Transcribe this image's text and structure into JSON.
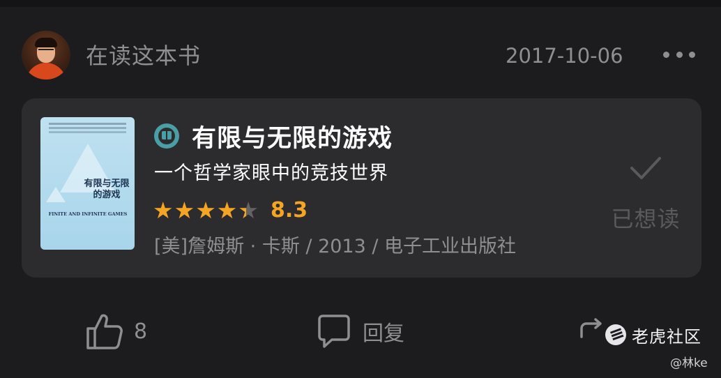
{
  "post": {
    "activity": "在读这本书",
    "date": "2017-10-06"
  },
  "book": {
    "title": "有限与无限的游戏",
    "subtitle": "一个哲学家眼中的竞技世界",
    "rating_stars": 4.5,
    "score": "8.3",
    "meta": "[美]詹姆斯 · 卡斯 / 2013 / 电子工业出版社",
    "cover_title": "有限与无限的游戏",
    "cover_en": "FINITE AND INFINITE GAMES",
    "want_read_label": "已想读"
  },
  "actions": {
    "like_count": "8",
    "reply_label": "回复"
  },
  "watermark": {
    "brand": "老虎社区",
    "credit": "@林ke"
  },
  "colors": {
    "background": "#1c1c1e",
    "card": "#2c2c2e",
    "accent_star": "#f5a524",
    "book_icon": "#4a9fa6",
    "muted_text": "#8e8e93"
  }
}
